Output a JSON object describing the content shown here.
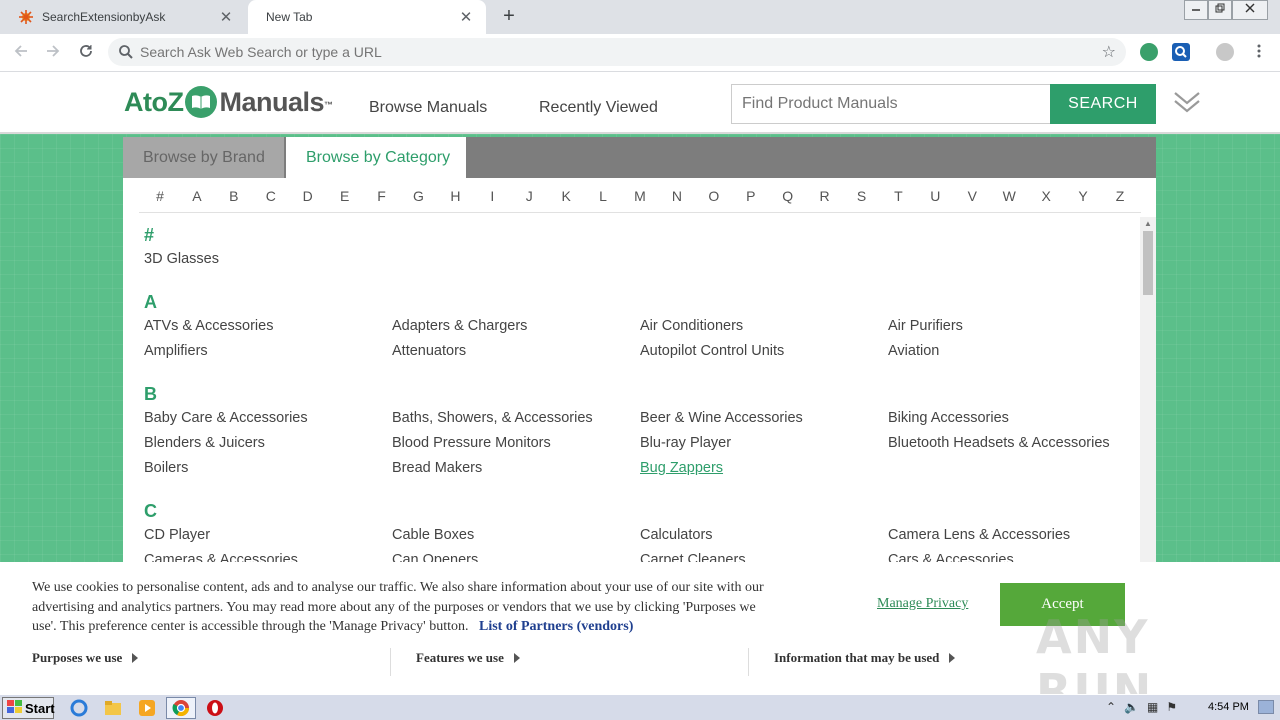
{
  "browser": {
    "tabs": [
      {
        "title": "SearchExtensionbyAsk",
        "icon": "ask-favicon-icon",
        "active": false
      },
      {
        "title": "New Tab",
        "active": true
      }
    ],
    "close_glyph": "✕",
    "new_tab_glyph": "+",
    "omnibox": {
      "placeholder": "Search Ask Web Search or type a URL",
      "value": ""
    },
    "window_controls": [
      "minimize",
      "restore",
      "close"
    ]
  },
  "site": {
    "logo": {
      "part1": "AtoZ",
      "part2": "Manuals",
      "tm": "™"
    },
    "nav": [
      "Browse Manuals",
      "Recently Viewed"
    ],
    "search": {
      "placeholder": "Find Product Manuals",
      "button": "SEARCH"
    },
    "accent_color": "#2e9e6b"
  },
  "panel": {
    "tabs": [
      {
        "label": "Browse by Brand",
        "active": false
      },
      {
        "label": "Browse by Category",
        "active": true
      }
    ],
    "alphabet": [
      "#",
      "A",
      "B",
      "C",
      "D",
      "E",
      "F",
      "G",
      "H",
      "I",
      "J",
      "K",
      "L",
      "M",
      "N",
      "O",
      "P",
      "Q",
      "R",
      "S",
      "T",
      "U",
      "V",
      "W",
      "X",
      "Y",
      "Z"
    ],
    "sections": [
      {
        "letter": "#",
        "items": [
          "3D Glasses"
        ]
      },
      {
        "letter": "A",
        "items": [
          "ATVs & Accessories",
          "Adapters & Chargers",
          "Air Conditioners",
          "Air Purifiers",
          "Amplifiers",
          "Attenuators",
          "Autopilot Control Units",
          "Aviation"
        ]
      },
      {
        "letter": "B",
        "items": [
          "Baby Care & Accessories",
          "Baths, Showers, & Accessories",
          "Beer & Wine Accessories",
          "Biking Accessories",
          "Blenders & Juicers",
          "Blood Pressure Monitors",
          "Blu-ray Player",
          "Bluetooth Headsets & Accessories",
          "Boilers",
          "Bread Makers",
          "Bug Zappers"
        ]
      },
      {
        "letter": "C",
        "items": [
          "CD Player",
          "Cable Boxes",
          "Calculators",
          "Camera Lens & Accessories",
          "Cameras & Accessories",
          "Can Openers",
          "Carpet Cleaners",
          "Cars & Accessories"
        ]
      }
    ],
    "hovered_item": "Bug Zappers"
  },
  "cookie": {
    "text": "We use cookies to personalise content, ads and to analyse our traffic. We also share information about your use of our site with our advertising and analytics partners. You may read more about any of the purposes or vendors that we use by clicking 'Purposes we use'. This preference center is accessible through the 'Manage Privacy' button.",
    "partners_link": "List of Partners (vendors)",
    "manage": "Manage Privacy",
    "accept": "Accept",
    "sections": [
      "Purposes we use",
      "Features we use",
      "Information that may be used"
    ]
  },
  "watermark": "ANY RUN",
  "taskbar": {
    "start": "Start",
    "time": "4:54 PM"
  }
}
